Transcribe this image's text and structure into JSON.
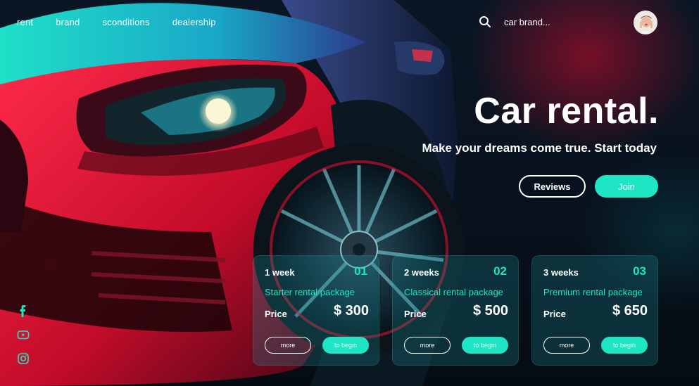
{
  "nav": {
    "items": [
      "rent",
      "brand",
      "sconditions",
      "dealership"
    ]
  },
  "search": {
    "icon": "search-icon",
    "text": "car brand..."
  },
  "avatar": {
    "icon": "user-avatar"
  },
  "hero": {
    "title": "Car rental.",
    "subtitle": "Make your dreams come true. Start today",
    "reviews_label": "Reviews",
    "join_label": "Join"
  },
  "cards": [
    {
      "period": "1 week",
      "number": "01",
      "package": "Starter rental package",
      "price_label": "Price",
      "price": "$ 300",
      "more_label": "more",
      "begin_label": "to begin"
    },
    {
      "period": "2 weeks",
      "number": "02",
      "package": "Classical rental package",
      "price_label": "Price",
      "price": "$ 500",
      "more_label": "more",
      "begin_label": "to begin"
    },
    {
      "period": "3 weeks",
      "number": "03",
      "package": "Premium rental package",
      "price_label": "Price",
      "price": "$ 650",
      "more_label": "more",
      "begin_label": "to begin"
    }
  ],
  "social": [
    "facebook-icon",
    "youtube-icon",
    "instagram-icon"
  ],
  "colors": {
    "accent": "#1ee6c5",
    "background": "#07111c",
    "car_red": "#d8102e",
    "car_teal": "#18c9b8"
  }
}
